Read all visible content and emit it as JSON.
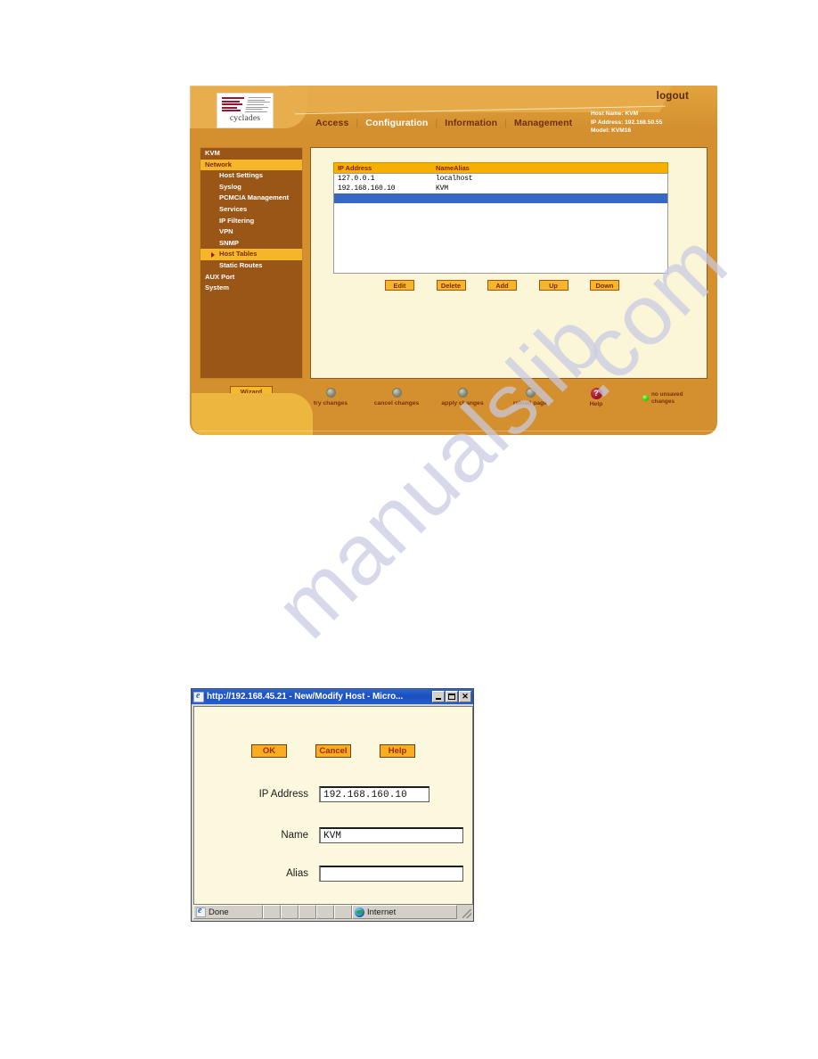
{
  "app": {
    "logo": {
      "word": "cyclades"
    },
    "logout_label": "logout",
    "nav": [
      {
        "label": "Access",
        "active": false
      },
      {
        "label": "Configuration",
        "active": true
      },
      {
        "label": "Information",
        "active": false
      },
      {
        "label": "Management",
        "active": false
      }
    ],
    "nav_separator": "|",
    "host_info": {
      "host_name": "Host Name: KVM",
      "ip_address": "IP Address: 192.168.50.55",
      "model": "Model: KVM16"
    },
    "sidebar": {
      "items": [
        {
          "label": "KVM",
          "level": "top",
          "active": false,
          "arrow": false
        },
        {
          "label": "Network",
          "level": "top",
          "active": true,
          "arrow": false
        },
        {
          "label": "Host Settings",
          "level": "sub",
          "active": false,
          "arrow": false
        },
        {
          "label": "Syslog",
          "level": "sub",
          "active": false,
          "arrow": false
        },
        {
          "label": "PCMCIA Management",
          "level": "sub",
          "active": false,
          "arrow": false
        },
        {
          "label": "Services",
          "level": "sub",
          "active": false,
          "arrow": false
        },
        {
          "label": "IP Filtering",
          "level": "sub",
          "active": false,
          "arrow": false
        },
        {
          "label": "VPN",
          "level": "sub",
          "active": false,
          "arrow": false
        },
        {
          "label": "SNMP",
          "level": "sub",
          "active": false,
          "arrow": false
        },
        {
          "label": "Host Tables",
          "level": "sub",
          "active": true,
          "arrow": true
        },
        {
          "label": "Static Routes",
          "level": "sub",
          "active": false,
          "arrow": false
        },
        {
          "label": "AUX Port",
          "level": "top",
          "active": false,
          "arrow": false
        },
        {
          "label": "System",
          "level": "top",
          "active": false,
          "arrow": false
        }
      ],
      "wizard_label": "Wizard"
    },
    "table": {
      "columns": [
        "IP Address",
        "NameAlias"
      ],
      "rows": [
        {
          "ip": "127.0.0.1",
          "name": "localhost",
          "selected": false
        },
        {
          "ip": "192.168.160.10",
          "name": "KVM",
          "selected": false
        },
        {
          "ip": "",
          "name": "",
          "selected": true
        }
      ]
    },
    "action_buttons": [
      "Edit",
      "Delete",
      "Add",
      "Up",
      "Down"
    ],
    "footer": {
      "actions": [
        {
          "label": "try changes",
          "icon": "led-button-icon"
        },
        {
          "label": "cancel changes",
          "icon": "led-button-icon"
        },
        {
          "label": "apply changes",
          "icon": "led-button-icon"
        },
        {
          "label": "reload page",
          "icon": "led-button-icon"
        },
        {
          "label": "Help",
          "icon": "help-question-icon"
        }
      ],
      "status_label": "no unsaved changes"
    }
  },
  "dialog": {
    "title": "http://192.168.45.21 - New/Modify Host - Micro...",
    "window_buttons": {
      "minimize": "_",
      "maximize": "□",
      "close": "✕"
    },
    "buttons": [
      "OK",
      "Cancel",
      "Help"
    ],
    "fields": [
      {
        "label": "IP Address",
        "value": "192.168.160.10",
        "placeholder": ""
      },
      {
        "label": "Name",
        "value": "KVM",
        "placeholder": ""
      },
      {
        "label": "Alias",
        "value": "",
        "placeholder": ""
      }
    ],
    "status": {
      "left": "Done",
      "zone": "Internet"
    }
  },
  "watermark": {
    "line1": "manualslib",
    "line2": ".com"
  }
}
